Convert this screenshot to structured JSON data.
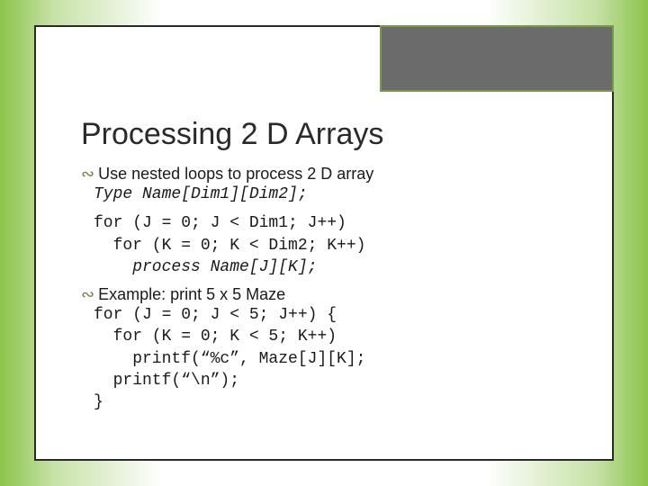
{
  "slide": {
    "title": "Processing 2 D Arrays",
    "bullet1": {
      "icon": "∾",
      "text": "Use nested loops to process 2 D array"
    },
    "code1": {
      "line1": "Type Name[Dim1][Dim2];",
      "line2": "for (J = 0; J < Dim1; J++)",
      "line3": "  for (K = 0; K < Dim2; K++)",
      "line4": "    process Name[J][K];"
    },
    "bullet2": {
      "icon": "∾",
      "text": "Example: print 5 x 5 Maze"
    },
    "code2": {
      "line1": "for (J = 0; J < 5; J++) {",
      "line2": "  for (K = 0; K < 5; K++)",
      "line3": "    printf(“%c”, Maze[J][K];",
      "line4": "  printf(“\\n”);",
      "line5": "}"
    }
  }
}
